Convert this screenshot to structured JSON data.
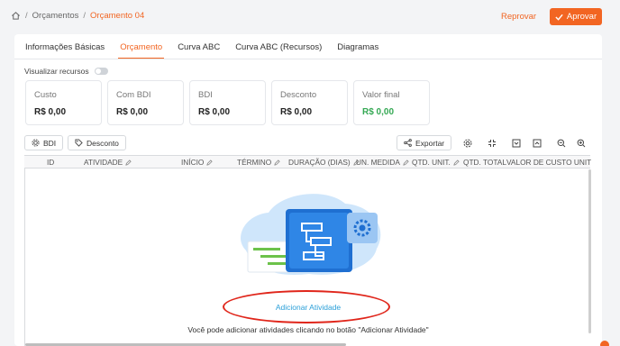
{
  "breadcrumb": {
    "items": [
      "Orçamentos",
      "Orçamento 04"
    ]
  },
  "header": {
    "reject_label": "Reprovar",
    "approve_label": "Aprovar"
  },
  "tabs": [
    "Informações Básicas",
    "Orçamento",
    "Curva ABC",
    "Curva ABC (Recursos)",
    "Diagramas"
  ],
  "active_tab": "Orçamento",
  "toggle": {
    "label": "Visualizar recursos",
    "on": false
  },
  "metrics": [
    {
      "label": "Custo",
      "value": "R$ 0,00"
    },
    {
      "label": "Com BDI",
      "value": "R$ 0,00"
    },
    {
      "label": "BDI",
      "value": "R$ 0,00"
    },
    {
      "label": "Desconto",
      "value": "R$ 0,00"
    },
    {
      "label": "Valor final",
      "value": "R$ 0,00"
    }
  ],
  "toolbar": {
    "bdi_label": "BDI",
    "discount_label": "Desconto",
    "export_label": "Exportar"
  },
  "table": {
    "columns": [
      "ID",
      "ATIVIDADE",
      "INÍCIO",
      "TÉRMINO",
      "DURAÇÃO (DIAS)",
      "UN. MEDIDA",
      "QTD. UNIT.",
      "QTD. TOTAL",
      "VALOR DE CUSTO UNIT"
    ]
  },
  "empty_state": {
    "add_label": "Adicionar Atividade",
    "hint": "Você pode adicionar atividades clicando no botão \"Adicionar Atividade\""
  },
  "colors": {
    "accent": "#f26522",
    "link": "#2a9fd8",
    "positive": "#34a853",
    "annotation": "#e0261b"
  }
}
